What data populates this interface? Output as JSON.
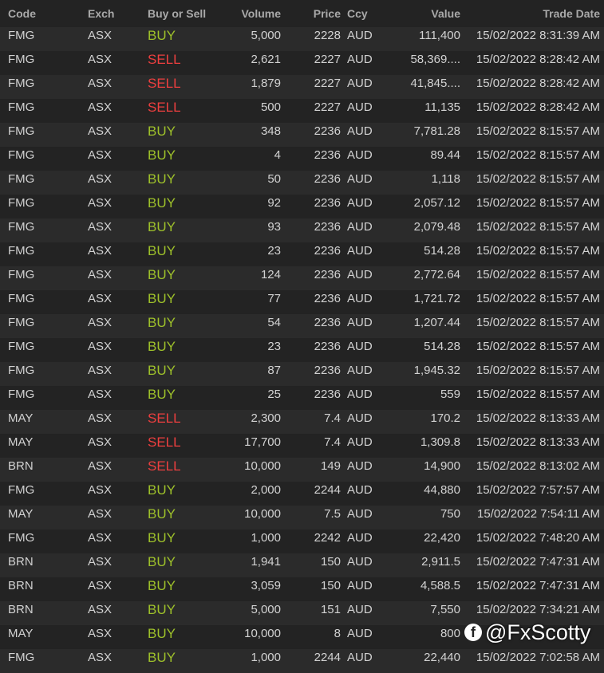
{
  "columns": {
    "code": "Code",
    "exch": "Exch",
    "side": "Buy or Sell",
    "volume": "Volume",
    "price": "Price",
    "ccy": "Ccy",
    "value": "Value",
    "trade_date": "Trade Date"
  },
  "rows": [
    {
      "code": "FMG",
      "exch": "ASX",
      "side": "BUY",
      "volume": "5,000",
      "price": "2228",
      "ccy": "AUD",
      "value": "111,400",
      "trade_date": "15/02/2022 8:31:39 AM"
    },
    {
      "code": "FMG",
      "exch": "ASX",
      "side": "SELL",
      "volume": "2,621",
      "price": "2227",
      "ccy": "AUD",
      "value": "58,369....",
      "trade_date": "15/02/2022 8:28:42 AM"
    },
    {
      "code": "FMG",
      "exch": "ASX",
      "side": "SELL",
      "volume": "1,879",
      "price": "2227",
      "ccy": "AUD",
      "value": "41,845....",
      "trade_date": "15/02/2022 8:28:42 AM"
    },
    {
      "code": "FMG",
      "exch": "ASX",
      "side": "SELL",
      "volume": "500",
      "price": "2227",
      "ccy": "AUD",
      "value": "11,135",
      "trade_date": "15/02/2022 8:28:42 AM"
    },
    {
      "code": "FMG",
      "exch": "ASX",
      "side": "BUY",
      "volume": "348",
      "price": "2236",
      "ccy": "AUD",
      "value": "7,781.28",
      "trade_date": "15/02/2022 8:15:57 AM"
    },
    {
      "code": "FMG",
      "exch": "ASX",
      "side": "BUY",
      "volume": "4",
      "price": "2236",
      "ccy": "AUD",
      "value": "89.44",
      "trade_date": "15/02/2022 8:15:57 AM"
    },
    {
      "code": "FMG",
      "exch": "ASX",
      "side": "BUY",
      "volume": "50",
      "price": "2236",
      "ccy": "AUD",
      "value": "1,118",
      "trade_date": "15/02/2022 8:15:57 AM"
    },
    {
      "code": "FMG",
      "exch": "ASX",
      "side": "BUY",
      "volume": "92",
      "price": "2236",
      "ccy": "AUD",
      "value": "2,057.12",
      "trade_date": "15/02/2022 8:15:57 AM"
    },
    {
      "code": "FMG",
      "exch": "ASX",
      "side": "BUY",
      "volume": "93",
      "price": "2236",
      "ccy": "AUD",
      "value": "2,079.48",
      "trade_date": "15/02/2022 8:15:57 AM"
    },
    {
      "code": "FMG",
      "exch": "ASX",
      "side": "BUY",
      "volume": "23",
      "price": "2236",
      "ccy": "AUD",
      "value": "514.28",
      "trade_date": "15/02/2022 8:15:57 AM"
    },
    {
      "code": "FMG",
      "exch": "ASX",
      "side": "BUY",
      "volume": "124",
      "price": "2236",
      "ccy": "AUD",
      "value": "2,772.64",
      "trade_date": "15/02/2022 8:15:57 AM"
    },
    {
      "code": "FMG",
      "exch": "ASX",
      "side": "BUY",
      "volume": "77",
      "price": "2236",
      "ccy": "AUD",
      "value": "1,721.72",
      "trade_date": "15/02/2022 8:15:57 AM"
    },
    {
      "code": "FMG",
      "exch": "ASX",
      "side": "BUY",
      "volume": "54",
      "price": "2236",
      "ccy": "AUD",
      "value": "1,207.44",
      "trade_date": "15/02/2022 8:15:57 AM"
    },
    {
      "code": "FMG",
      "exch": "ASX",
      "side": "BUY",
      "volume": "23",
      "price": "2236",
      "ccy": "AUD",
      "value": "514.28",
      "trade_date": "15/02/2022 8:15:57 AM"
    },
    {
      "code": "FMG",
      "exch": "ASX",
      "side": "BUY",
      "volume": "87",
      "price": "2236",
      "ccy": "AUD",
      "value": "1,945.32",
      "trade_date": "15/02/2022 8:15:57 AM"
    },
    {
      "code": "FMG",
      "exch": "ASX",
      "side": "BUY",
      "volume": "25",
      "price": "2236",
      "ccy": "AUD",
      "value": "559",
      "trade_date": "15/02/2022 8:15:57 AM"
    },
    {
      "code": "MAY",
      "exch": "ASX",
      "side": "SELL",
      "volume": "2,300",
      "price": "7.4",
      "ccy": "AUD",
      "value": "170.2",
      "trade_date": "15/02/2022 8:13:33 AM"
    },
    {
      "code": "MAY",
      "exch": "ASX",
      "side": "SELL",
      "volume": "17,700",
      "price": "7.4",
      "ccy": "AUD",
      "value": "1,309.8",
      "trade_date": "15/02/2022 8:13:33 AM"
    },
    {
      "code": "BRN",
      "exch": "ASX",
      "side": "SELL",
      "volume": "10,000",
      "price": "149",
      "ccy": "AUD",
      "value": "14,900",
      "trade_date": "15/02/2022 8:13:02 AM"
    },
    {
      "code": "FMG",
      "exch": "ASX",
      "side": "BUY",
      "volume": "2,000",
      "price": "2244",
      "ccy": "AUD",
      "value": "44,880",
      "trade_date": "15/02/2022 7:57:57 AM"
    },
    {
      "code": "MAY",
      "exch": "ASX",
      "side": "BUY",
      "volume": "10,000",
      "price": "7.5",
      "ccy": "AUD",
      "value": "750",
      "trade_date": "15/02/2022 7:54:11 AM"
    },
    {
      "code": "FMG",
      "exch": "ASX",
      "side": "BUY",
      "volume": "1,000",
      "price": "2242",
      "ccy": "AUD",
      "value": "22,420",
      "trade_date": "15/02/2022 7:48:20 AM"
    },
    {
      "code": "BRN",
      "exch": "ASX",
      "side": "BUY",
      "volume": "1,941",
      "price": "150",
      "ccy": "AUD",
      "value": "2,911.5",
      "trade_date": "15/02/2022 7:47:31 AM"
    },
    {
      "code": "BRN",
      "exch": "ASX",
      "side": "BUY",
      "volume": "3,059",
      "price": "150",
      "ccy": "AUD",
      "value": "4,588.5",
      "trade_date": "15/02/2022 7:47:31 AM"
    },
    {
      "code": "BRN",
      "exch": "ASX",
      "side": "BUY",
      "volume": "5,000",
      "price": "151",
      "ccy": "AUD",
      "value": "7,550",
      "trade_date": "15/02/2022 7:34:21 AM"
    },
    {
      "code": "MAY",
      "exch": "ASX",
      "side": "BUY",
      "volume": "10,000",
      "price": "8",
      "ccy": "AUD",
      "value": "800",
      "trade_date": ""
    },
    {
      "code": "FMG",
      "exch": "ASX",
      "side": "BUY",
      "volume": "1,000",
      "price": "2244",
      "ccy": "AUD",
      "value": "22,440",
      "trade_date": "15/02/2022 7:02:58 AM"
    }
  ],
  "colors": {
    "background": "#232323",
    "row_alt": "#2b2b2b",
    "buy": "#9ec12a",
    "sell": "#ee3f3f",
    "header_text": "#a9a9a9",
    "text": "#d2d2d2"
  },
  "watermark": {
    "icon": "facebook-icon",
    "text": "@FxScotty"
  }
}
